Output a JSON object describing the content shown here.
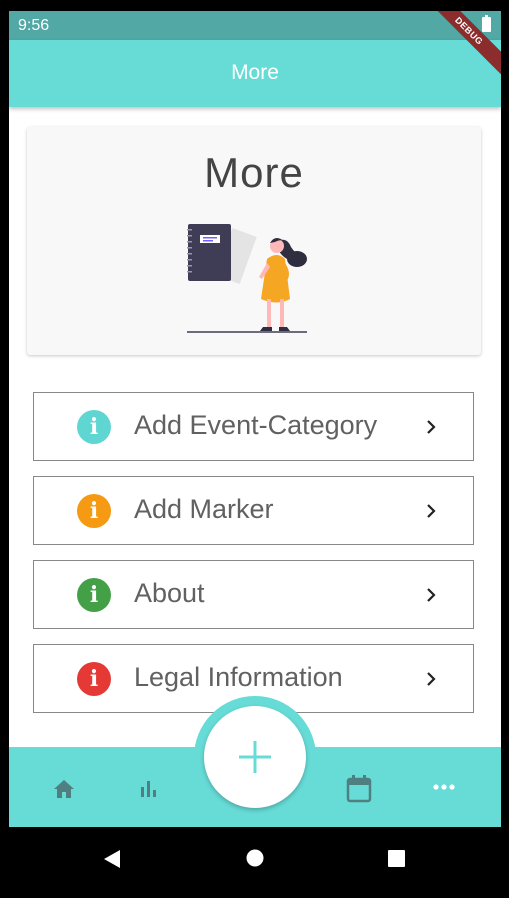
{
  "status_bar": {
    "time": "9:56",
    "debug_label": "DEBUG"
  },
  "app_bar": {
    "title": "More"
  },
  "header_card": {
    "title": "More"
  },
  "menu": {
    "items": [
      {
        "label": "Add Event-Category",
        "icon": "info-icon",
        "icon_glyph": "i",
        "color": "#5fd6d2"
      },
      {
        "label": "Add Marker",
        "icon": "info-icon",
        "icon_glyph": "i",
        "color": "#f59a12"
      },
      {
        "label": "About",
        "icon": "info-icon",
        "icon_glyph": "i",
        "color": "#43a047"
      },
      {
        "label": "Legal Information",
        "icon": "info-icon",
        "icon_glyph": "i",
        "color": "#e53935"
      }
    ]
  },
  "bottom_nav": {
    "items": [
      "home-icon",
      "bar-chart-icon",
      "add-icon",
      "calendar-icon",
      "more-horiz-icon"
    ]
  },
  "colors": {
    "accent": "#67dcd7",
    "status_bar": "#52a8a4",
    "nav_icon": "#4f7f80"
  }
}
